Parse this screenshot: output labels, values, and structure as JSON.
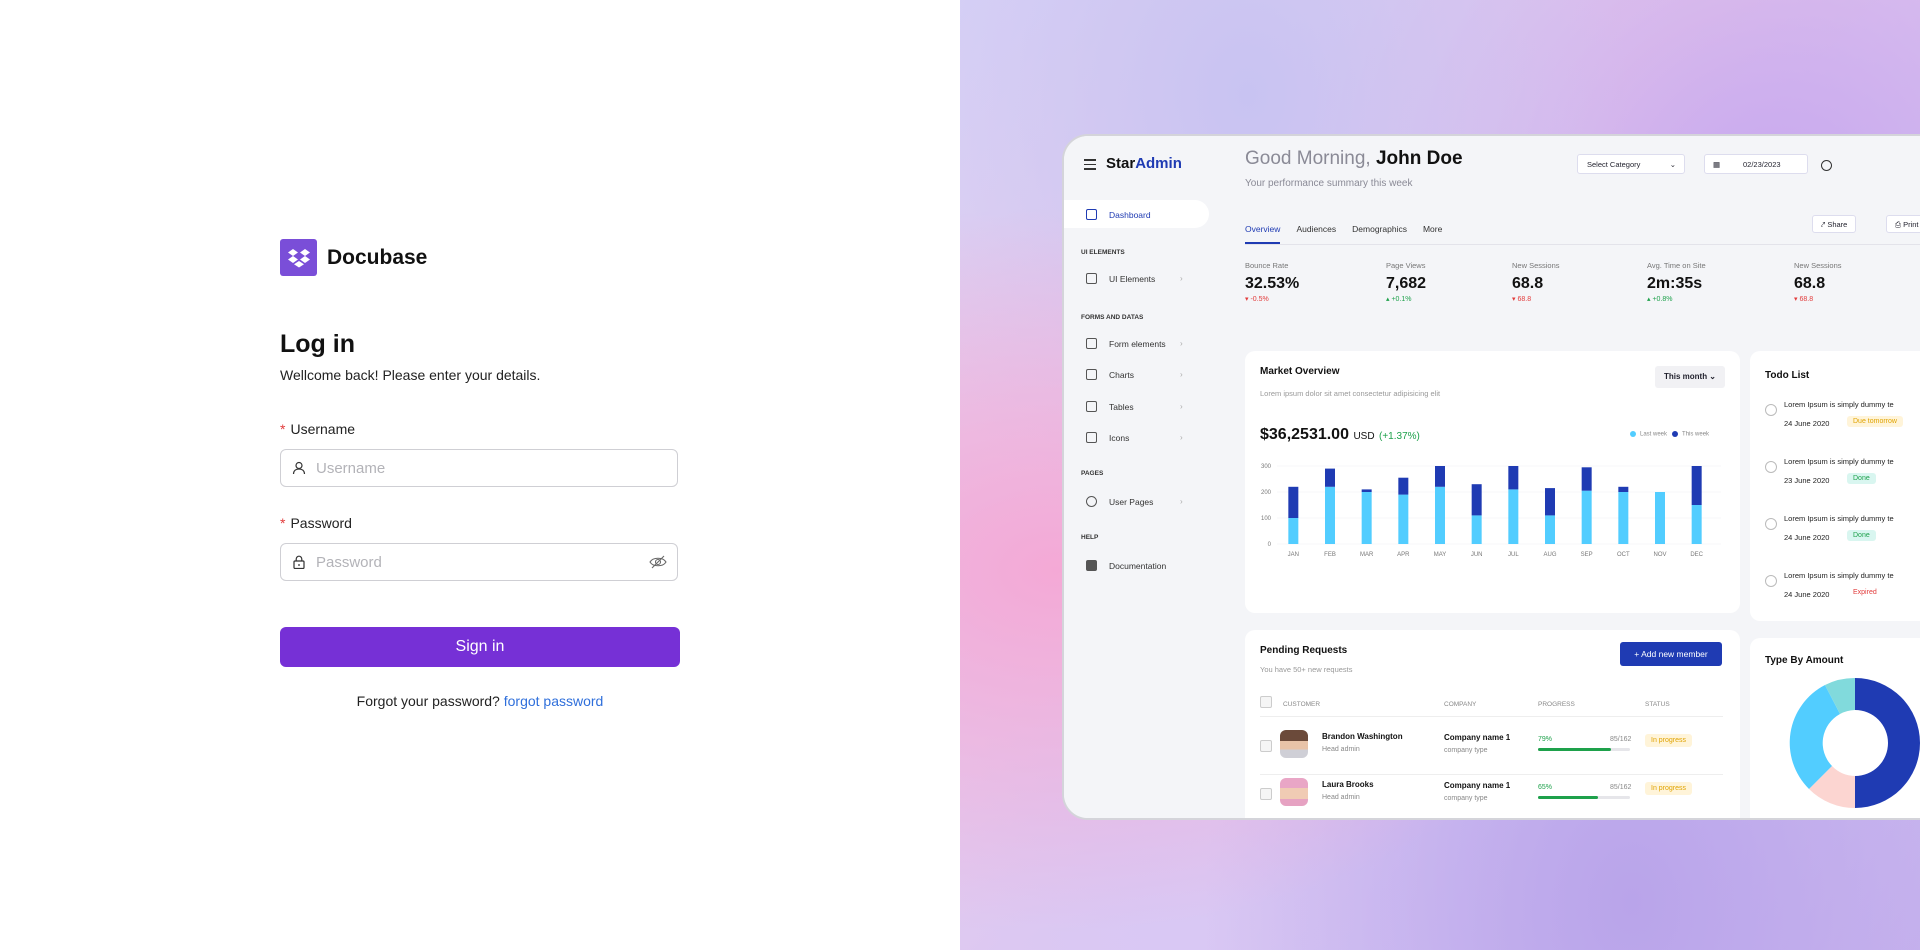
{
  "login": {
    "brand": "Docubase",
    "title": "Log in",
    "subtitle": "Wellcome back! Please enter your details.",
    "username_label": "Username",
    "username_placeholder": "Username",
    "password_label": "Password",
    "password_placeholder": "Password",
    "signin_label": "Sign in",
    "forgot_text": "Forgot your password?",
    "forgot_link": "forgot password",
    "accent_color": "#7630d6"
  },
  "dashboard": {
    "sidebar": {
      "brand_star": "Star",
      "brand_admin": "Admin",
      "items": {
        "dashboard": "Dashboard",
        "ui_section": "UI ELEMENTS",
        "ui_elements": "UI Elements",
        "forms_section": "FORMS AND DATAS",
        "form_elements": "Form elements",
        "charts": "Charts",
        "tables": "Tables",
        "icons": "Icons",
        "pages_section": "PAGES",
        "user_pages": "User Pages",
        "help_section": "HELP",
        "documentation": "Documentation"
      }
    },
    "header": {
      "greeting": "Good Morning,",
      "name": "John Doe",
      "subtitle": "Your performance summary this week",
      "select_category": "Select Category",
      "date": "02/23/2023"
    },
    "tabs": [
      "Overview",
      "Audiences",
      "Demographics",
      "More"
    ],
    "actions": {
      "share": "Share",
      "print": "Print"
    },
    "stats": [
      {
        "label": "Bounce Rate",
        "value": "32.53%",
        "delta": "-0.5%",
        "dir": "down"
      },
      {
        "label": "Page Views",
        "value": "7,682",
        "delta": "+0.1%",
        "dir": "up"
      },
      {
        "label": "New Sessions",
        "value": "68.8",
        "delta": "68.8",
        "dir": "down"
      },
      {
        "label": "Avg. Time on Site",
        "value": "2m:35s",
        "delta": "+0.8%",
        "dir": "up"
      },
      {
        "label": "New Sessions",
        "value": "68.8",
        "delta": "68.8",
        "dir": "down"
      }
    ],
    "market": {
      "title": "Market Overview",
      "subtitle": "Lorem ipsum dolor sit amet consectetur adipisicing elit",
      "period": "This month",
      "amount": "$36,2531.00",
      "currency": "USD",
      "change": "(+1.37%)",
      "legend_last": "Last week",
      "legend_this": "This week"
    },
    "todo": {
      "title": "Todo List",
      "items": [
        {
          "text": "Lorem Ipsum is simply dummy te",
          "date": "24 June 2020",
          "badge": "Due tomorrow",
          "badge_color": "#e0a300",
          "badge_bg": "#fff4d9"
        },
        {
          "text": "Lorem Ipsum is simply dummy te",
          "date": "23 June 2020",
          "badge": "Done",
          "badge_color": "#1ea14b",
          "badge_bg": "#d9f6f0"
        },
        {
          "text": "Lorem Ipsum is simply dummy te",
          "date": "24 June 2020",
          "badge": "Done",
          "badge_color": "#1ea14b",
          "badge_bg": "#d9f6f0"
        },
        {
          "text": "Lorem Ipsum is simply dummy te",
          "date": "24 June 2020",
          "badge": "Expired",
          "badge_color": "#e23b3b",
          "badge_bg": "transparent"
        }
      ]
    },
    "pending": {
      "title": "Pending Requests",
      "subtitle": "You have 50+ new requests",
      "add_button": "Add new member",
      "columns": [
        "CUSTOMER",
        "COMPANY",
        "PROGRESS",
        "STATUS"
      ],
      "rows": [
        {
          "name": "Brandon Washington",
          "role": "Head admin",
          "company": "Company name 1",
          "company_type": "company type",
          "pct": "79%",
          "pct_value": 0.79,
          "frac": "85/162",
          "status": "In progress"
        },
        {
          "name": "Laura Brooks",
          "role": "Head admin",
          "company": "Company name 1",
          "company_type": "company type",
          "pct": "65%",
          "pct_value": 0.65,
          "frac": "85/162",
          "status": "In progress"
        }
      ]
    },
    "type_by_amount": {
      "title": "Type By Amount"
    }
  },
  "chart_data": {
    "type": "bar",
    "categories": [
      "JAN",
      "FEB",
      "MAR",
      "APR",
      "MAY",
      "JUN",
      "JUL",
      "AUG",
      "SEP",
      "OCT",
      "NOV",
      "DEC"
    ],
    "series": [
      {
        "name": "Last week",
        "values": [
          100,
          220,
          200,
          190,
          220,
          110,
          210,
          110,
          205,
          200,
          200,
          150
        ],
        "color": "#52cdff"
      },
      {
        "name": "This week",
        "values": [
          120,
          70,
          10,
          65,
          80,
          120,
          90,
          105,
          90,
          20,
          0,
          150
        ],
        "color": "#1f3bb3"
      }
    ],
    "stacked": true,
    "yticks": [
      0,
      100,
      200,
      300
    ],
    "ylim": [
      0,
      300
    ]
  }
}
